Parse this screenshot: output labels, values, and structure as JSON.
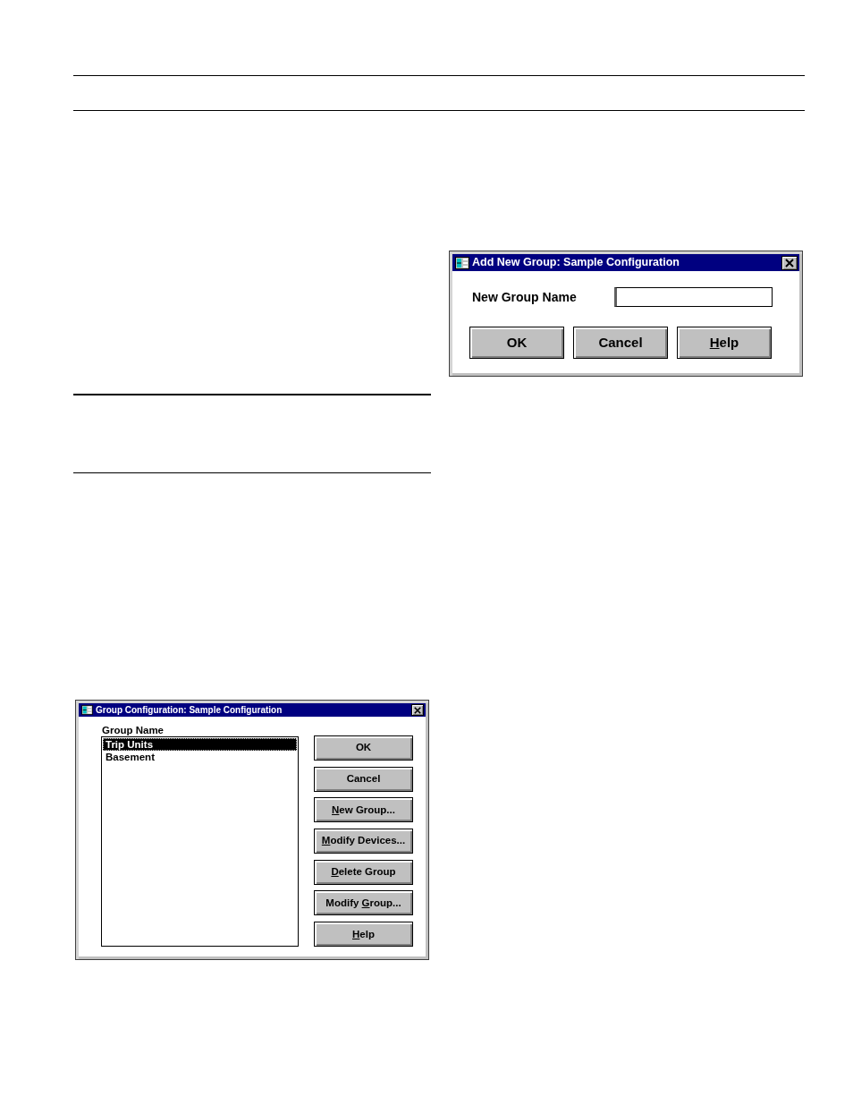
{
  "add_new_group_dialog": {
    "title": "Add New Group: Sample Configuration",
    "field": {
      "label": "New Group Name"
    },
    "buttons": [
      {
        "text": "OK"
      },
      {
        "text": "Cancel"
      },
      {
        "mnemonic": "H",
        "after": "elp"
      }
    ]
  },
  "group_configuration_dialog": {
    "title": "Group Configuration: Sample Configuration",
    "list_label": "Group Name",
    "items": [
      {
        "name": "Trip Units",
        "selected": true
      },
      {
        "name": "Basement",
        "selected": false
      }
    ],
    "buttons": [
      {
        "text": "OK"
      },
      {
        "text": "Cancel"
      },
      {
        "mnemonic": "N",
        "after": "ew Group..."
      },
      {
        "mnemonic": "M",
        "after": "odify Devices..."
      },
      {
        "mnemonic": "D",
        "after": "elete Group"
      },
      {
        "before": "Modify ",
        "mnemonic": "G",
        "after": "roup..."
      },
      {
        "mnemonic": "H",
        "after": "elp"
      }
    ]
  }
}
